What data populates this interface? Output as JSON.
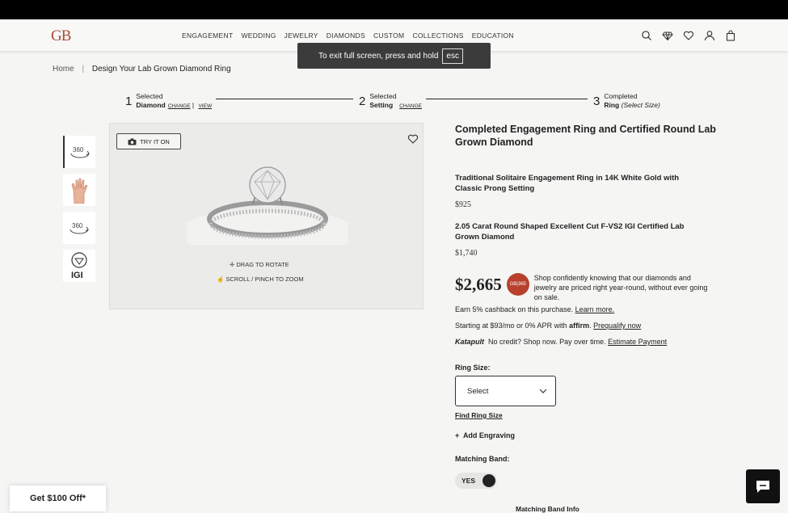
{
  "header": {
    "logo": "GB",
    "nav": [
      "ENGAGEMENT",
      "WEDDING",
      "JEWELRY",
      "DIAMONDS",
      "CUSTOM",
      "COLLECTIONS",
      "EDUCATION"
    ]
  },
  "toast": {
    "message": "To exit full screen, press and hold",
    "key": "esc"
  },
  "breadcrumb": {
    "home": "Home",
    "separator": "|",
    "current": "Design Your Lab Grown Diamond Ring"
  },
  "steps": [
    {
      "num": "1",
      "top": "Selected",
      "label": "Diamond",
      "links": [
        "CHANGE",
        "VIEW"
      ]
    },
    {
      "num": "2",
      "top": "Selected",
      "label": "Setting",
      "links": [
        "CHANGE"
      ]
    },
    {
      "num": "3",
      "top": "Completed",
      "label": "Ring",
      "note": "(Select Size)"
    }
  ],
  "thumbs": [
    "360",
    "hand",
    "360",
    "IGI"
  ],
  "viewer": {
    "try_on": "TRY IT ON",
    "hint_rotate": "DRAG TO ROTATE",
    "hint_zoom": "SCROLL / PINCH TO ZOOM"
  },
  "product": {
    "title": "Completed Engagement Ring and Certified Round Lab Grown Diamond",
    "setting_title": "Traditional Solitaire Engagement Ring in 14K White Gold with Classic Prong Setting",
    "setting_price": "$925",
    "diamond_title": "2.05 Carat Round Shaped Excellent Cut F-VS2 IGI Certified Lab Grown Diamond",
    "diamond_price": "$1,740",
    "total": "$2,665",
    "badge": "GB|365",
    "confidence": "Shop confidently knowing that our diamonds and jewelry are priced right year-round, without ever going on sale.",
    "cashback": "Earn 5% cashback on this purchase.",
    "cashback_link": "Learn more.",
    "affirm_prefix": "Starting at $93/mo or 0% APR with",
    "affirm_brand": "affirm",
    "affirm_link": "Prequalify now",
    "katapult_brand": "Katapult",
    "katapult_text": "No credit? Shop now. Pay over time.",
    "katapult_link": "Estimate Payment",
    "ring_size_label": "Ring Size:",
    "ring_size_value": "Select",
    "find_size": "Find Ring Size",
    "engraving": "Add Engraving",
    "band_label": "Matching Band:",
    "band_toggle": "YES",
    "band_info": "Matching Band Info"
  },
  "promo": "Get $100 Off*"
}
